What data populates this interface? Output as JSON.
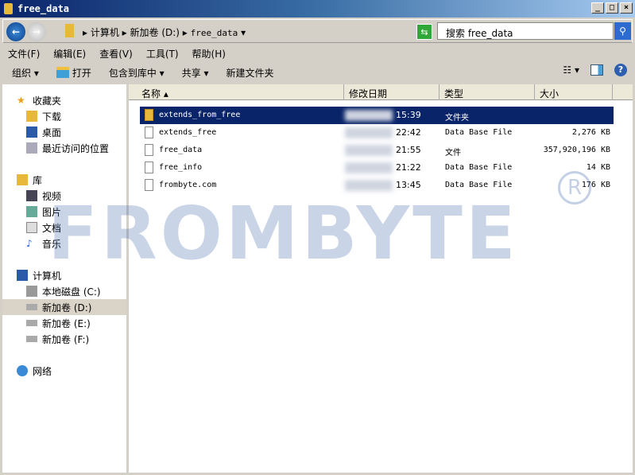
{
  "window": {
    "title": "free_data",
    "min": "_",
    "max": "□",
    "close": "×"
  },
  "address": {
    "crumbs": [
      "计算机",
      "新加卷 (D:)",
      "free_data"
    ]
  },
  "search": {
    "placeholder": "搜索 free_data"
  },
  "menu": [
    "文件(F)",
    "编辑(E)",
    "查看(V)",
    "工具(T)",
    "帮助(H)"
  ],
  "toolbar": {
    "organize": "组织 ▾",
    "open": "打开",
    "include": "包含到库中 ▾",
    "share": "共享 ▾",
    "new_folder": "新建文件夹"
  },
  "sidebar": {
    "favorites": "收藏夹",
    "fav_items": [
      "下载",
      "桌面",
      "最近访问的位置"
    ],
    "libraries": "库",
    "lib_items": [
      "视频",
      "图片",
      "文档",
      "音乐"
    ],
    "computer": "计算机",
    "drives": [
      "本地磁盘 (C:)",
      "新加卷 (D:)",
      "新加卷 (E:)",
      "新加卷 (F:)"
    ],
    "network": "网络"
  },
  "columns": [
    "名称",
    "修改日期",
    "类型",
    "大小"
  ],
  "files": [
    {
      "name": "extends_from_free",
      "time": "15:39",
      "type": "文件夹",
      "size": "",
      "icon": "folder-icon"
    },
    {
      "name": "extends_free",
      "time": "22:42",
      "type": "Data Base File",
      "size": "2,276 KB",
      "icon": "database-file-icon"
    },
    {
      "name": "free_data",
      "time": "21:55",
      "type": "文件",
      "size": "357,920,196 KB",
      "icon": "file-icon"
    },
    {
      "name": "free_info",
      "time": "21:22",
      "type": "Data Base File",
      "size": "14 KB",
      "icon": "database-file-icon"
    },
    {
      "name": "frombyte.com",
      "time": "13:45",
      "type": "Data Base File",
      "size": "176 KB",
      "icon": "database-file-icon"
    }
  ],
  "watermark": "FROMBYTE"
}
